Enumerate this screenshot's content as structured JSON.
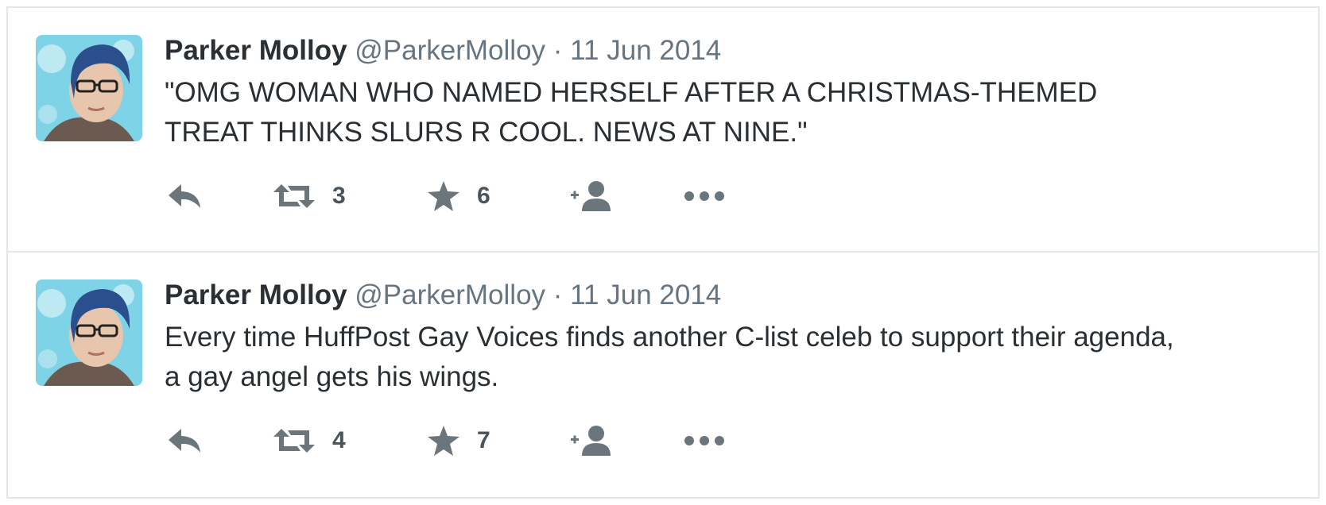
{
  "tweets": [
    {
      "name": "Parker Molloy",
      "handle": "@ParkerMolloy",
      "separator": "·",
      "time": "11 Jun 2014",
      "text": "\"OMG WOMAN WHO NAMED HERSELF AFTER A CHRISTMAS-THEMED TREAT THINKS SLURS R COOL. NEWS AT NINE.\"",
      "retweets": "3",
      "favorites": "6"
    },
    {
      "name": "Parker Molloy",
      "handle": "@ParkerMolloy",
      "separator": "·",
      "time": "11 Jun 2014",
      "text": "Every time HuffPost Gay Voices finds another C-list celeb to support their agenda, a gay angel gets his wings.",
      "retweets": "4",
      "favorites": "7"
    }
  ],
  "icons": {
    "reply": "reply-icon",
    "retweet": "retweet-icon",
    "favorite": "star-icon",
    "follow": "follow-icon",
    "more": "more-icon"
  },
  "colors": {
    "text": "#292f33",
    "secondary": "#66757f",
    "icon": "#6b757c",
    "border": "#e1e8ed"
  }
}
